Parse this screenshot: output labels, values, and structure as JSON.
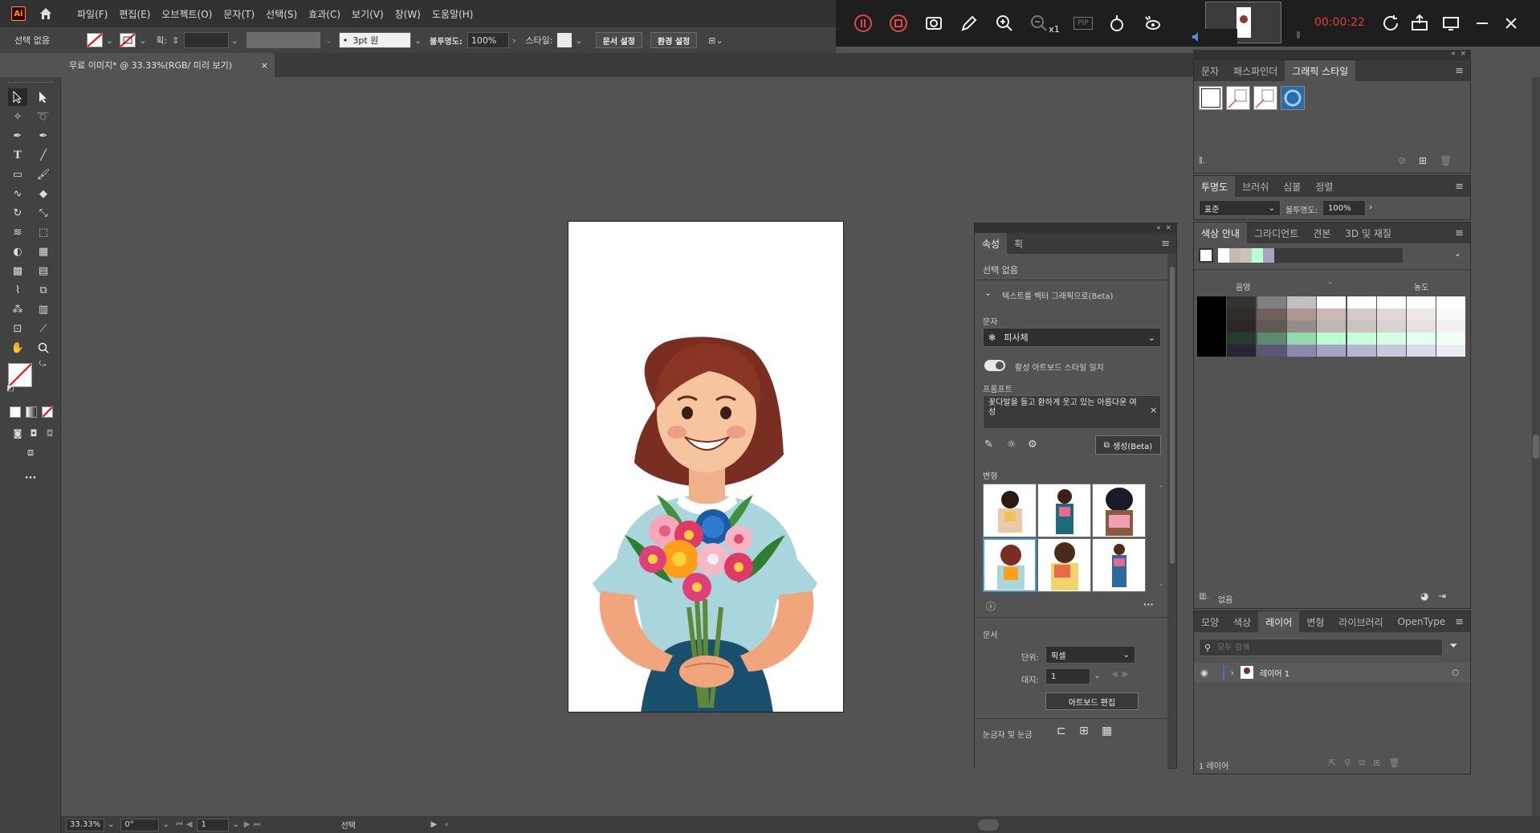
{
  "app": {
    "logo_text": "Ai",
    "menus": [
      "파일(F)",
      "편집(E)",
      "오브젝트(O)",
      "문자(T)",
      "선택(S)",
      "효과(C)",
      "보기(V)",
      "창(W)",
      "도움말(H)"
    ]
  },
  "recorder": {
    "time": "00:00:22",
    "zoom_label": "x1",
    "pip_label": "PIP"
  },
  "control_bar": {
    "selection": "선택 없음",
    "stroke_label": "획:",
    "stroke_profile": "3pt 원",
    "opacity_label": "불투명도:",
    "opacity_value": "100%",
    "style_label": "스타일:",
    "doc_setup_button": "문서 설정",
    "prefs_button": "환경 설정"
  },
  "document": {
    "tab_title": "무료 이미지* @ 33.33%(RGB/ 미리 보기)",
    "close": "×"
  },
  "status_bar": {
    "zoom": "33.33%",
    "rotation": "0°",
    "artboard_num": "1",
    "tool": "선택"
  },
  "properties_panel": {
    "tabs": [
      "속성",
      "획"
    ],
    "selection": "선택 없음",
    "section_title": "텍스트를 벡터 그래픽으로(Beta)",
    "type_label": "문자",
    "type_value": "피사체",
    "toggle_label": "활성 아트보드 스타일 일치",
    "prompt_label": "프롬프트",
    "prompt_text": "꽃다발을 들고 환하게 웃고 있는 아름다운 여성",
    "generate_button": "생성(Beta)",
    "variations_label": "변형",
    "document_label": "문서",
    "units_label": "단위:",
    "units_value": "픽셀",
    "artboard_label": "대지:",
    "artboard_value": "1",
    "edit_artboards_button": "아트보드 편집",
    "rulers_label": "눈금자 및 눈금"
  },
  "graphic_styles_panel": {
    "tabs": [
      "문자",
      "패스파인더",
      "그래픽 스타일"
    ]
  },
  "transparency_panel": {
    "tabs": [
      "투명도",
      "브러쉬",
      "심볼",
      "정렬"
    ],
    "blend_mode": "표준",
    "opacity_label": "불투명도:",
    "opacity_value": "100%"
  },
  "color_guide_panel": {
    "tabs": [
      "색상 안내",
      "그라디언트",
      "견본",
      "3D 및 재질"
    ],
    "shade_label": "음영",
    "tint_label": "농도",
    "footer_label": "없음",
    "harmony_colors": [
      "#ffffff",
      "#c7b7b5",
      "#c9c2bd",
      "#b9ffd6",
      "#a5a3c0"
    ],
    "grid_colors": [
      [
        "#000000",
        "#333333",
        "#808080",
        "#c0c0c0",
        "#ffffff",
        "#ffffff",
        "#ffffff",
        "#ffffff",
        "#ffffff"
      ],
      [
        "#000000",
        "#302a29",
        "#6f5f5d",
        "#ad9693",
        "#c9b8b6",
        "#d6c8c6",
        "#e2d8d7",
        "#efe8e7",
        "#fbf8f8"
      ],
      [
        "#000000",
        "#2b2928",
        "#605a56",
        "#948d88",
        "#bdb6b1",
        "#cac4c0",
        "#d8d3d0",
        "#e5e2e0",
        "#f3f1ef"
      ],
      [
        "#000000",
        "#263b2e",
        "#5b8a6c",
        "#95d8ad",
        "#b9ffd3",
        "#c7ffdc",
        "#d5ffe5",
        "#e3ffee",
        "#f1fff7"
      ],
      [
        "#000000",
        "#272633",
        "#595775",
        "#8c89b0",
        "#a6a4c4",
        "#b7b5d0",
        "#c8c7dc",
        "#dad9e7",
        "#ebebf3"
      ]
    ]
  },
  "layers_panel": {
    "tabs": [
      "모양",
      "색상",
      "레이어",
      "변형",
      "라이브러리",
      "OpenType"
    ],
    "search_placeholder": "모두 검색",
    "layer_name": "레이어 1",
    "footer": "1 레이어"
  }
}
